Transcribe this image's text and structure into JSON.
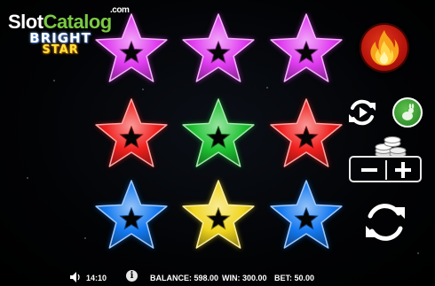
{
  "watermark": {
    "part1": "Slot",
    "part2": "Catalog",
    "suffix": ".com"
  },
  "logo": {
    "line1": "BRIGHT",
    "line2": "STAR"
  },
  "reels": {
    "rows": [
      [
        {
          "symbol": "star",
          "color": "#e03cf0"
        },
        {
          "symbol": "star",
          "color": "#e03cf0"
        },
        {
          "symbol": "star",
          "color": "#e03cf0"
        }
      ],
      [
        {
          "symbol": "star",
          "color": "#f0201e"
        },
        {
          "symbol": "star",
          "color": "#1fc232"
        },
        {
          "symbol": "star",
          "color": "#f0201e"
        }
      ],
      [
        {
          "symbol": "star",
          "color": "#1479f0"
        },
        {
          "symbol": "star",
          "color": "#f0d51c"
        },
        {
          "symbol": "star",
          "color": "#1479f0"
        }
      ]
    ]
  },
  "controls": {
    "feature_icon": "fire-icon",
    "autoplay_icon": "autoplay-icon",
    "turbo_icon": "rabbit-icon",
    "coins_icon": "coins-icon",
    "bet_minus_icon": "minus-icon",
    "bet_plus_icon": "plus-icon",
    "spin_icon": "spin-icon"
  },
  "status_bar": {
    "sound_icon": "speaker-icon",
    "time": "14:10",
    "info_icon": "i",
    "balance": "BALANCE: 598.00",
    "win": "WIN: 300.00",
    "bet": "BET: 50.00"
  },
  "colors": {
    "magenta": "#e03cf0",
    "red": "#f0201e",
    "green": "#1fc232",
    "blue": "#1479f0",
    "yellow": "#f0d51c",
    "fire_button": "#c81a10",
    "turbo_button": "#2e8f2a"
  }
}
